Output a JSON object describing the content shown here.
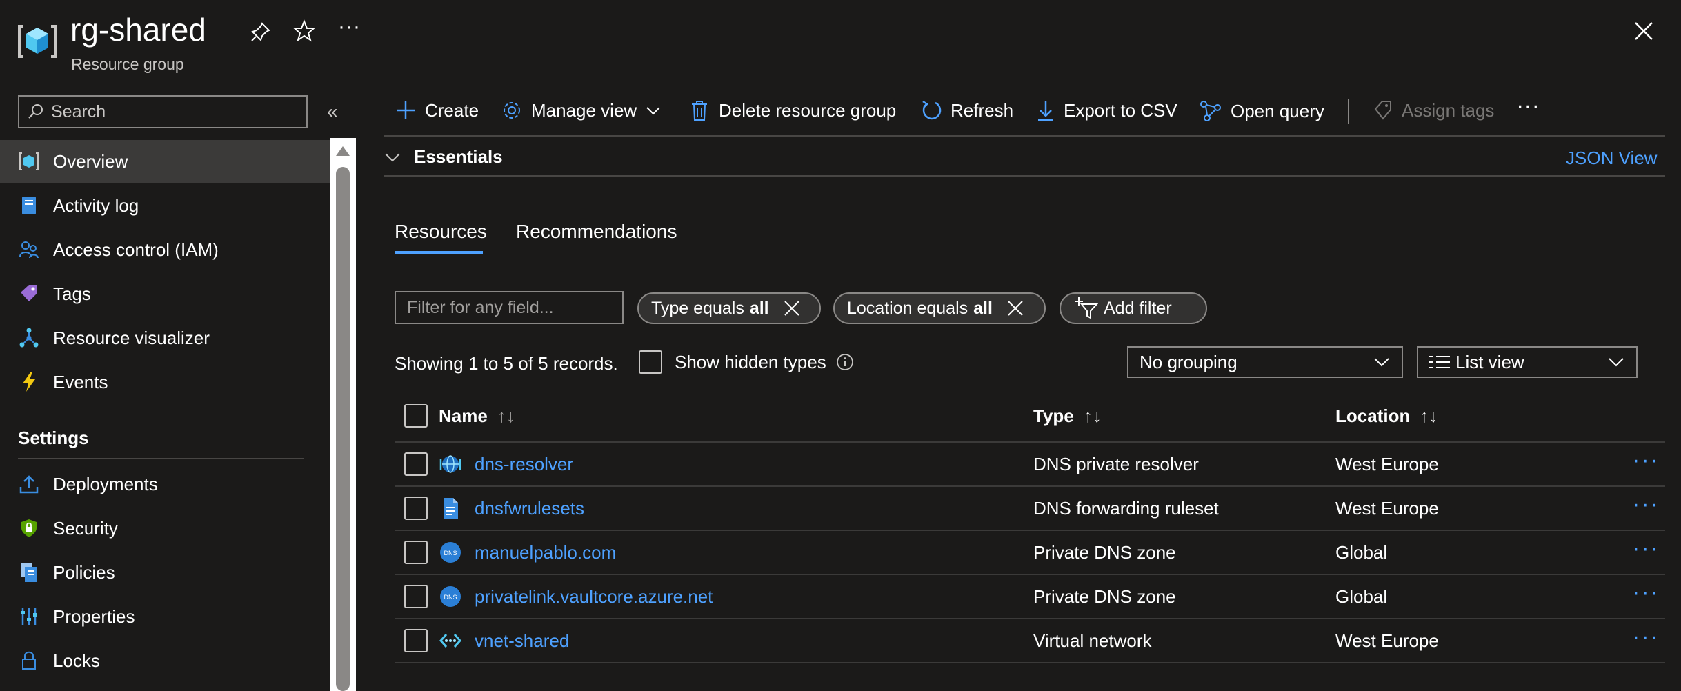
{
  "header": {
    "title": "rg-shared",
    "subtitle": "Resource group"
  },
  "sidebar": {
    "search_placeholder": "Search",
    "items": [
      {
        "label": "Overview",
        "icon": "overview-icon"
      },
      {
        "label": "Activity log",
        "icon": "activity-log-icon"
      },
      {
        "label": "Access control (IAM)",
        "icon": "iam-icon"
      },
      {
        "label": "Tags",
        "icon": "tag-icon"
      },
      {
        "label": "Resource visualizer",
        "icon": "visualizer-icon"
      },
      {
        "label": "Events",
        "icon": "lightning-icon"
      }
    ],
    "settings_heading": "Settings",
    "settings_items": [
      {
        "label": "Deployments",
        "icon": "deployments-icon"
      },
      {
        "label": "Security",
        "icon": "shield-icon"
      },
      {
        "label": "Policies",
        "icon": "policies-icon"
      },
      {
        "label": "Properties",
        "icon": "properties-icon"
      },
      {
        "label": "Locks",
        "icon": "lock-icon"
      }
    ]
  },
  "toolbar": {
    "create": "Create",
    "manage_view": "Manage view",
    "delete": "Delete resource group",
    "refresh": "Refresh",
    "export": "Export to CSV",
    "open_query": "Open query",
    "assign_tags": "Assign tags"
  },
  "essentials": {
    "label": "Essentials",
    "json_view": "JSON View"
  },
  "tabs": {
    "resources": "Resources",
    "recommendations": "Recommendations"
  },
  "filters": {
    "placeholder": "Filter for any field...",
    "type_pill_prefix": "Type equals",
    "type_pill_value": "all",
    "location_pill_prefix": "Location equals",
    "location_pill_value": "all",
    "add_filter": "Add filter"
  },
  "records_text": "Showing 1 to 5 of 5 records.",
  "show_hidden": "Show hidden types",
  "grouping": "No grouping",
  "view_mode": "List view",
  "table": {
    "headers": {
      "name": "Name",
      "type": "Type",
      "location": "Location"
    },
    "rows": [
      {
        "name": "dns-resolver",
        "type": "DNS private resolver",
        "location": "West Europe",
        "icon": "dns-resolver-icon"
      },
      {
        "name": "dnsfwrulesets",
        "type": "DNS forwarding ruleset",
        "location": "West Europe",
        "icon": "ruleset-icon"
      },
      {
        "name": "manuelpablo.com",
        "type": "Private DNS zone",
        "location": "Global",
        "icon": "dns-zone-icon"
      },
      {
        "name": "privatelink.vaultcore.azure.net",
        "type": "Private DNS zone",
        "location": "Global",
        "icon": "dns-zone-icon"
      },
      {
        "name": "vnet-shared",
        "type": "Virtual network",
        "location": "West Europe",
        "icon": "vnet-icon"
      }
    ]
  },
  "colors": {
    "background": "#1b1a19",
    "accent": "#4ea1ff",
    "selected_nav": "#3b3a39"
  }
}
